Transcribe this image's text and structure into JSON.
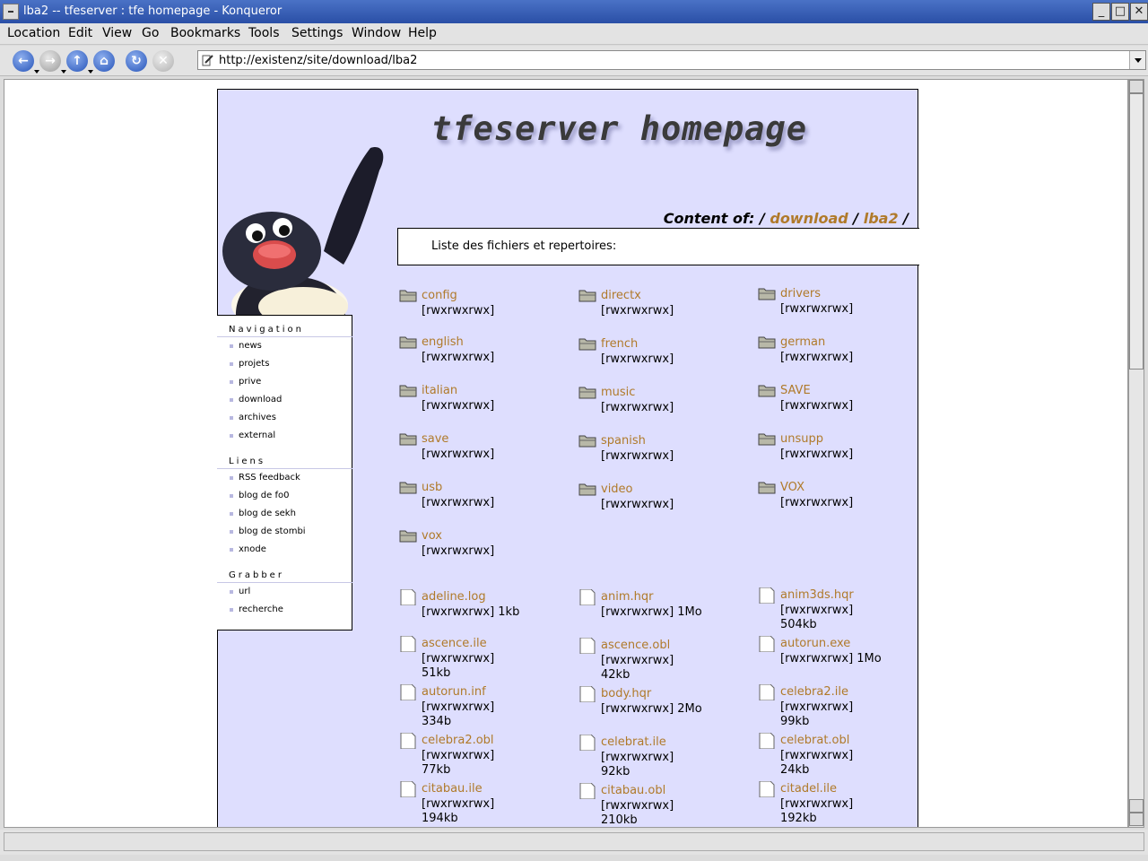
{
  "window": {
    "title": "lba2 -- tfeserver : tfe homepage - Konqueror",
    "buttons": [
      "_",
      "□",
      "✕"
    ]
  },
  "menu": [
    "Location",
    "Edit",
    "View",
    "Go",
    "Bookmarks",
    "Tools",
    "Settings",
    "Window",
    "Help"
  ],
  "toolbar": {
    "url": "http://existenz/site/download/lba2"
  },
  "page": {
    "site_title": "tfeserver homepage",
    "crumb_label": "Content of:",
    "crumb_sep": "/",
    "crumbs": [
      "download",
      "lba2"
    ],
    "list_heading": "Liste des fichiers et repertoires:"
  },
  "sidebar": {
    "sections": [
      {
        "title": "Navigation",
        "items": [
          "news",
          "projets",
          "prive",
          "download",
          "archives",
          "external"
        ]
      },
      {
        "title": "Liens",
        "items": [
          "RSS feedback",
          "blog de fo0",
          "blog de sekh",
          "blog de stombi",
          "xnode"
        ]
      },
      {
        "title": "Grabber",
        "items": [
          "url",
          "recherche"
        ]
      }
    ]
  },
  "directories": [
    {
      "name": "config",
      "perm": "[rwxrwxrwx]"
    },
    {
      "name": "directx",
      "perm": "[rwxrwxrwx]"
    },
    {
      "name": "drivers",
      "perm": "[rwxrwxrwx]"
    },
    {
      "name": "english",
      "perm": "[rwxrwxrwx]"
    },
    {
      "name": "french",
      "perm": "[rwxrwxrwx]"
    },
    {
      "name": "german",
      "perm": "[rwxrwxrwx]"
    },
    {
      "name": "italian",
      "perm": "[rwxrwxrwx]"
    },
    {
      "name": "music",
      "perm": "[rwxrwxrwx]"
    },
    {
      "name": "SAVE",
      "perm": "[rwxrwxrwx]"
    },
    {
      "name": "save",
      "perm": "[rwxrwxrwx]"
    },
    {
      "name": "spanish",
      "perm": "[rwxrwxrwx]"
    },
    {
      "name": "unsupp",
      "perm": "[rwxrwxrwx]"
    },
    {
      "name": "usb",
      "perm": "[rwxrwxrwx]"
    },
    {
      "name": "video",
      "perm": "[rwxrwxrwx]"
    },
    {
      "name": "VOX",
      "perm": "[rwxrwxrwx]"
    },
    {
      "name": "vox",
      "perm": "[rwxrwxrwx]"
    }
  ],
  "files": [
    {
      "name": "adeline.log",
      "perm": "[rwxrwxrwx] 1kb",
      "size": ""
    },
    {
      "name": "anim.hqr",
      "perm": "[rwxrwxrwx] 1Mo",
      "size": ""
    },
    {
      "name": "anim3ds.hqr",
      "perm": "[rwxrwxrwx]",
      "size": "504kb"
    },
    {
      "name": "ascence.ile",
      "perm": "[rwxrwxrwx]",
      "size": "51kb"
    },
    {
      "name": "ascence.obl",
      "perm": "[rwxrwxrwx]",
      "size": "42kb"
    },
    {
      "name": "autorun.exe",
      "perm": "[rwxrwxrwx] 1Mo",
      "size": ""
    },
    {
      "name": "autorun.inf",
      "perm": "[rwxrwxrwx]",
      "size": "334b"
    },
    {
      "name": "body.hqr",
      "perm": "[rwxrwxrwx] 2Mo",
      "size": ""
    },
    {
      "name": "celebra2.ile",
      "perm": "[rwxrwxrwx]",
      "size": "99kb"
    },
    {
      "name": "celebra2.obl",
      "perm": "[rwxrwxrwx]",
      "size": "77kb"
    },
    {
      "name": "celebrat.ile",
      "perm": "[rwxrwxrwx]",
      "size": "92kb"
    },
    {
      "name": "celebrat.obl",
      "perm": "[rwxrwxrwx]",
      "size": "24kb"
    },
    {
      "name": "citabau.ile",
      "perm": "[rwxrwxrwx]",
      "size": "194kb"
    },
    {
      "name": "citabau.obl",
      "perm": "[rwxrwxrwx]",
      "size": "210kb"
    },
    {
      "name": "citadel.ile",
      "perm": "[rwxrwxrwx]",
      "size": "192kb"
    }
  ]
}
